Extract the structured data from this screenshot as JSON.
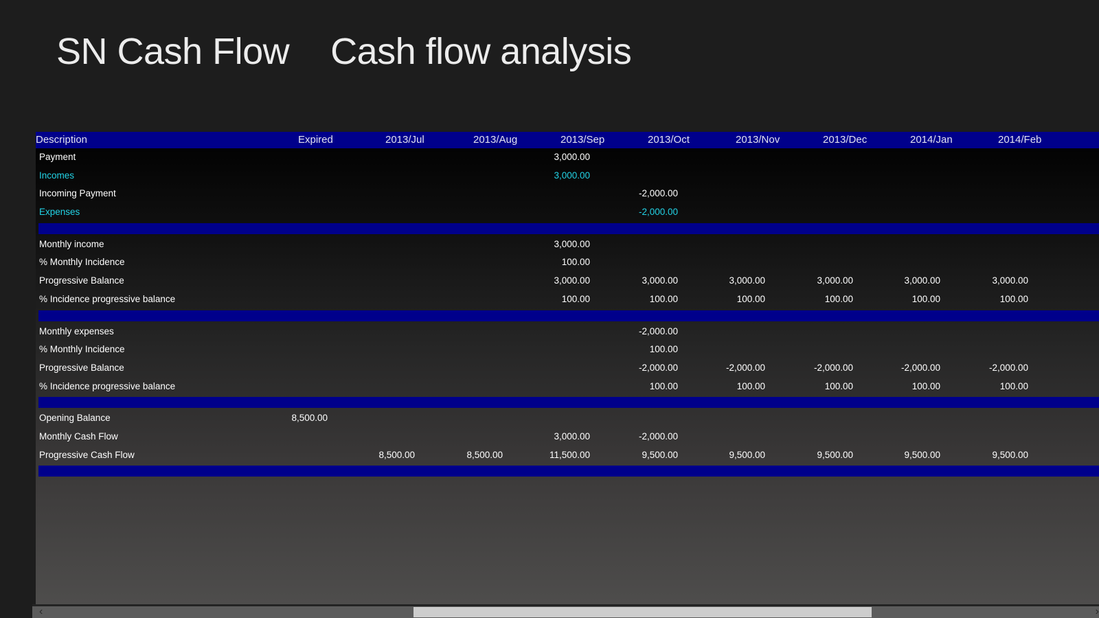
{
  "app": {
    "title": "SN Cash Flow",
    "page_title": "Cash flow analysis"
  },
  "table": {
    "columns": [
      "Description",
      "Expired",
      "2013/Jul",
      "2013/Aug",
      "2013/Sep",
      "2013/Oct",
      "2013/Nov",
      "2013/Dec",
      "2014/Jan",
      "2014/Feb"
    ],
    "sections": [
      {
        "rows": [
          {
            "desc": "Payment",
            "style": "normal",
            "values": [
              "",
              "",
              "",
              "3,000.00",
              "",
              "",
              "",
              "",
              ""
            ]
          },
          {
            "desc": "Incomes",
            "style": "cyan",
            "values": [
              "",
              "",
              "",
              "3,000.00",
              "",
              "",
              "",
              "",
              ""
            ]
          },
          {
            "desc": "Incoming Payment",
            "style": "normal",
            "values": [
              "",
              "",
              "",
              "",
              "-2,000.00",
              "",
              "",
              "",
              ""
            ]
          },
          {
            "desc": "Expenses",
            "style": "cyan",
            "values": [
              "",
              "",
              "",
              "",
              "-2,000.00",
              "",
              "",
              "",
              ""
            ]
          }
        ]
      },
      {
        "rows": [
          {
            "desc": "Monthly income",
            "style": "normal",
            "values": [
              "",
              "",
              "",
              "3,000.00",
              "",
              "",
              "",
              "",
              ""
            ]
          },
          {
            "desc": "% Monthly Incidence",
            "style": "normal",
            "values": [
              "",
              "",
              "",
              "100.00",
              "",
              "",
              "",
              "",
              ""
            ]
          },
          {
            "desc": "Progressive Balance",
            "style": "normal",
            "values": [
              "",
              "",
              "",
              "3,000.00",
              "3,000.00",
              "3,000.00",
              "3,000.00",
              "3,000.00",
              "3,000.00"
            ]
          },
          {
            "desc": "% Incidence progressive balance",
            "style": "normal",
            "values": [
              "",
              "",
              "",
              "100.00",
              "100.00",
              "100.00",
              "100.00",
              "100.00",
              "100.00"
            ]
          }
        ]
      },
      {
        "rows": [
          {
            "desc": "Monthly expenses",
            "style": "normal",
            "values": [
              "",
              "",
              "",
              "",
              "-2,000.00",
              "",
              "",
              "",
              ""
            ]
          },
          {
            "desc": "% Monthly Incidence",
            "style": "normal",
            "values": [
              "",
              "",
              "",
              "",
              "100.00",
              "",
              "",
              "",
              ""
            ]
          },
          {
            "desc": "Progressive Balance",
            "style": "normal",
            "values": [
              "",
              "",
              "",
              "",
              "-2,000.00",
              "-2,000.00",
              "-2,000.00",
              "-2,000.00",
              "-2,000.00"
            ]
          },
          {
            "desc": "% Incidence progressive balance",
            "style": "normal",
            "values": [
              "",
              "",
              "",
              "",
              "100.00",
              "100.00",
              "100.00",
              "100.00",
              "100.00"
            ]
          }
        ]
      },
      {
        "rows": [
          {
            "desc": "Opening Balance",
            "style": "normal",
            "values": [
              "8,500.00",
              "",
              "",
              "",
              "",
              "",
              "",
              "",
              ""
            ]
          },
          {
            "desc": "Monthly Cash Flow",
            "style": "normal",
            "values": [
              "",
              "",
              "",
              "3,000.00",
              "-2,000.00",
              "",
              "",
              "",
              ""
            ]
          },
          {
            "desc": "Progressive Cash Flow",
            "style": "normal",
            "values": [
              "",
              "8,500.00",
              "8,500.00",
              "11,500.00",
              "9,500.00",
              "9,500.00",
              "9,500.00",
              "9,500.00",
              "9,500.00"
            ]
          }
        ]
      }
    ]
  },
  "scrollbar": {
    "left_icon": "chevron-left-icon",
    "right_icon": "chevron-right-icon",
    "left_glyph": "‹",
    "right_glyph": "›"
  },
  "colors": {
    "header_bg": "#00008b",
    "accent_text": "#22d3e6"
  }
}
